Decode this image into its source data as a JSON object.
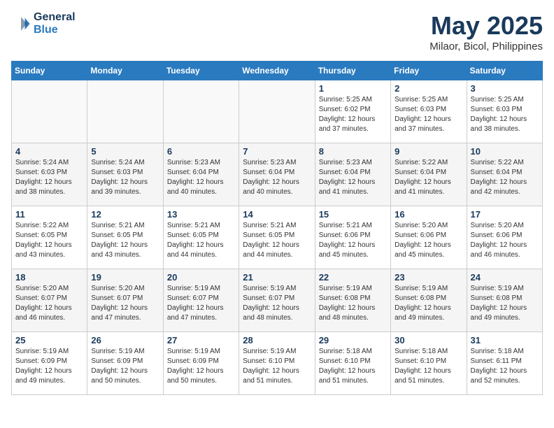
{
  "logo": {
    "line1": "General",
    "line2": "Blue"
  },
  "title": "May 2025",
  "location": "Milaor, Bicol, Philippines",
  "weekdays": [
    "Sunday",
    "Monday",
    "Tuesday",
    "Wednesday",
    "Thursday",
    "Friday",
    "Saturday"
  ],
  "weeks": [
    [
      {
        "day": "",
        "info": ""
      },
      {
        "day": "",
        "info": ""
      },
      {
        "day": "",
        "info": ""
      },
      {
        "day": "",
        "info": ""
      },
      {
        "day": "1",
        "info": "Sunrise: 5:25 AM\nSunset: 6:02 PM\nDaylight: 12 hours\nand 37 minutes."
      },
      {
        "day": "2",
        "info": "Sunrise: 5:25 AM\nSunset: 6:03 PM\nDaylight: 12 hours\nand 37 minutes."
      },
      {
        "day": "3",
        "info": "Sunrise: 5:25 AM\nSunset: 6:03 PM\nDaylight: 12 hours\nand 38 minutes."
      }
    ],
    [
      {
        "day": "4",
        "info": "Sunrise: 5:24 AM\nSunset: 6:03 PM\nDaylight: 12 hours\nand 38 minutes."
      },
      {
        "day": "5",
        "info": "Sunrise: 5:24 AM\nSunset: 6:03 PM\nDaylight: 12 hours\nand 39 minutes."
      },
      {
        "day": "6",
        "info": "Sunrise: 5:23 AM\nSunset: 6:04 PM\nDaylight: 12 hours\nand 40 minutes."
      },
      {
        "day": "7",
        "info": "Sunrise: 5:23 AM\nSunset: 6:04 PM\nDaylight: 12 hours\nand 40 minutes."
      },
      {
        "day": "8",
        "info": "Sunrise: 5:23 AM\nSunset: 6:04 PM\nDaylight: 12 hours\nand 41 minutes."
      },
      {
        "day": "9",
        "info": "Sunrise: 5:22 AM\nSunset: 6:04 PM\nDaylight: 12 hours\nand 41 minutes."
      },
      {
        "day": "10",
        "info": "Sunrise: 5:22 AM\nSunset: 6:04 PM\nDaylight: 12 hours\nand 42 minutes."
      }
    ],
    [
      {
        "day": "11",
        "info": "Sunrise: 5:22 AM\nSunset: 6:05 PM\nDaylight: 12 hours\nand 43 minutes."
      },
      {
        "day": "12",
        "info": "Sunrise: 5:21 AM\nSunset: 6:05 PM\nDaylight: 12 hours\nand 43 minutes."
      },
      {
        "day": "13",
        "info": "Sunrise: 5:21 AM\nSunset: 6:05 PM\nDaylight: 12 hours\nand 44 minutes."
      },
      {
        "day": "14",
        "info": "Sunrise: 5:21 AM\nSunset: 6:05 PM\nDaylight: 12 hours\nand 44 minutes."
      },
      {
        "day": "15",
        "info": "Sunrise: 5:21 AM\nSunset: 6:06 PM\nDaylight: 12 hours\nand 45 minutes."
      },
      {
        "day": "16",
        "info": "Sunrise: 5:20 AM\nSunset: 6:06 PM\nDaylight: 12 hours\nand 45 minutes."
      },
      {
        "day": "17",
        "info": "Sunrise: 5:20 AM\nSunset: 6:06 PM\nDaylight: 12 hours\nand 46 minutes."
      }
    ],
    [
      {
        "day": "18",
        "info": "Sunrise: 5:20 AM\nSunset: 6:07 PM\nDaylight: 12 hours\nand 46 minutes."
      },
      {
        "day": "19",
        "info": "Sunrise: 5:20 AM\nSunset: 6:07 PM\nDaylight: 12 hours\nand 47 minutes."
      },
      {
        "day": "20",
        "info": "Sunrise: 5:19 AM\nSunset: 6:07 PM\nDaylight: 12 hours\nand 47 minutes."
      },
      {
        "day": "21",
        "info": "Sunrise: 5:19 AM\nSunset: 6:07 PM\nDaylight: 12 hours\nand 48 minutes."
      },
      {
        "day": "22",
        "info": "Sunrise: 5:19 AM\nSunset: 6:08 PM\nDaylight: 12 hours\nand 48 minutes."
      },
      {
        "day": "23",
        "info": "Sunrise: 5:19 AM\nSunset: 6:08 PM\nDaylight: 12 hours\nand 49 minutes."
      },
      {
        "day": "24",
        "info": "Sunrise: 5:19 AM\nSunset: 6:08 PM\nDaylight: 12 hours\nand 49 minutes."
      }
    ],
    [
      {
        "day": "25",
        "info": "Sunrise: 5:19 AM\nSunset: 6:09 PM\nDaylight: 12 hours\nand 49 minutes."
      },
      {
        "day": "26",
        "info": "Sunrise: 5:19 AM\nSunset: 6:09 PM\nDaylight: 12 hours\nand 50 minutes."
      },
      {
        "day": "27",
        "info": "Sunrise: 5:19 AM\nSunset: 6:09 PM\nDaylight: 12 hours\nand 50 minutes."
      },
      {
        "day": "28",
        "info": "Sunrise: 5:19 AM\nSunset: 6:10 PM\nDaylight: 12 hours\nand 51 minutes."
      },
      {
        "day": "29",
        "info": "Sunrise: 5:18 AM\nSunset: 6:10 PM\nDaylight: 12 hours\nand 51 minutes."
      },
      {
        "day": "30",
        "info": "Sunrise: 5:18 AM\nSunset: 6:10 PM\nDaylight: 12 hours\nand 51 minutes."
      },
      {
        "day": "31",
        "info": "Sunrise: 5:18 AM\nSunset: 6:11 PM\nDaylight: 12 hours\nand 52 minutes."
      }
    ]
  ]
}
